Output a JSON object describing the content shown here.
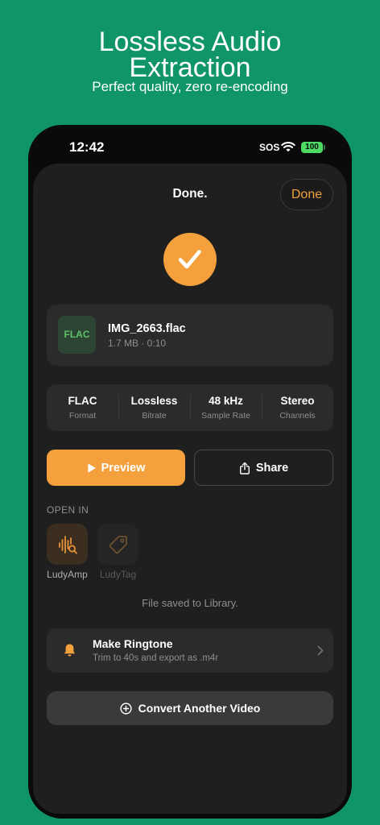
{
  "promo": {
    "title": "Lossless Audio Extraction",
    "subtitle": "Perfect quality, zero re-encoding"
  },
  "status_bar": {
    "time": "12:42",
    "sos_label": "SOS",
    "battery_level": "100"
  },
  "sheet": {
    "title": "Done.",
    "done_label": "Done",
    "status_icon": "checkmark-icon"
  },
  "file": {
    "format_badge": "FLAC",
    "name": "IMG_2663.flac",
    "meta": "1.7 MB · 0:10"
  },
  "stats": [
    {
      "value": "FLAC",
      "label": "Format"
    },
    {
      "value": "Lossless",
      "label": "Bitrate"
    },
    {
      "value": "48 kHz",
      "label": "Sample Rate"
    },
    {
      "value": "Stereo",
      "label": "Channels"
    }
  ],
  "actions": {
    "preview_label": "Preview",
    "preview_icon": "play-icon",
    "share_label": "Share",
    "share_icon": "share-icon"
  },
  "open_in": {
    "heading": "OPEN IN",
    "apps": [
      {
        "name": "LudyAmp",
        "icon": "waveform-search-icon",
        "enabled": true
      },
      {
        "name": "LudyTag",
        "icon": "tag-icon",
        "enabled": false
      }
    ]
  },
  "saved_note": "File saved to Library.",
  "ringtone": {
    "icon": "bell-icon",
    "title": "Make Ringtone",
    "subtitle": "Trim to 40s and export as .m4r"
  },
  "convert": {
    "icon": "plus-circle-icon",
    "label": "Convert Another Video"
  },
  "colors": {
    "background": "#0f9568",
    "accent": "#f4a03c",
    "sheet": "#1f1f1f",
    "card": "#2b2b2b",
    "badge_text": "#5fbf6a",
    "battery": "#4cd964"
  }
}
